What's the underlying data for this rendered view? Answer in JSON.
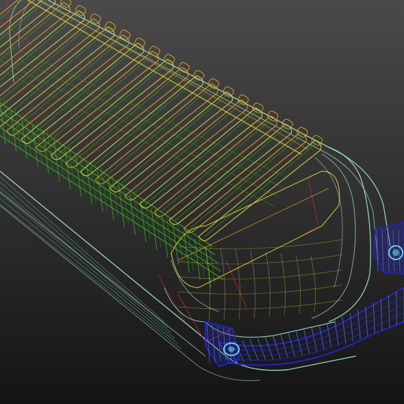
{
  "scene": {
    "subject": "wireframe-3d-model",
    "background_top": "#4a4a4a",
    "background_bottom": "#141414",
    "colors": {
      "shell": "#9fe8c8",
      "shell_dim": "#6fbf9e",
      "inner_green": "#2db814",
      "inner_green_dark": "#1f8f10",
      "slats": "#d8d23a",
      "slats_orange": "#e0a020",
      "red": "#b8283c",
      "blue": "#2424d8",
      "blue_light": "#4a6aff",
      "cyan_dot": "#6ad0e8"
    },
    "slat_count": 20
  }
}
